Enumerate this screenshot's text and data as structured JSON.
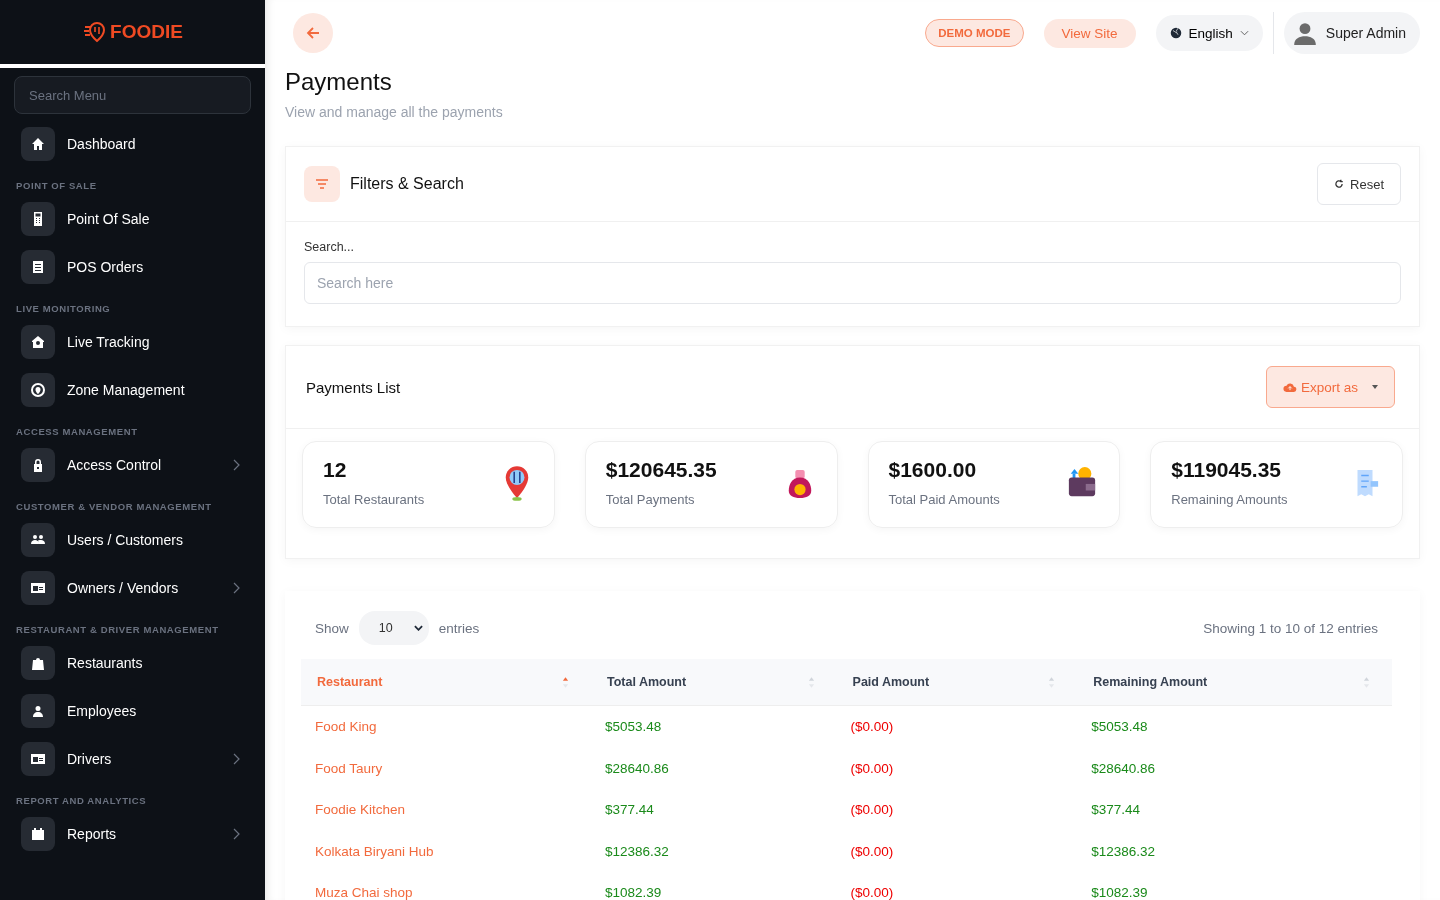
{
  "brand": "FOODIE",
  "sidebar": {
    "search_placeholder": "Search Menu",
    "sections": [
      {
        "items": [
          {
            "label": "Dashboard",
            "has_submenu": false
          }
        ]
      },
      {
        "heading": "POINT OF SALE",
        "items": [
          {
            "label": "Point Of Sale",
            "has_submenu": false
          },
          {
            "label": "POS Orders",
            "has_submenu": false
          }
        ]
      },
      {
        "heading": "LIVE MONITORING",
        "items": [
          {
            "label": "Live Tracking",
            "has_submenu": false
          },
          {
            "label": "Zone Management",
            "has_submenu": false
          }
        ]
      },
      {
        "heading": "ACCESS MANAGEMENT",
        "items": [
          {
            "label": "Access Control",
            "has_submenu": true
          }
        ]
      },
      {
        "heading": "CUSTOMER & VENDOR MANAGEMENT",
        "items": [
          {
            "label": "Users / Customers",
            "has_submenu": false
          },
          {
            "label": "Owners / Vendors",
            "has_submenu": true
          }
        ]
      },
      {
        "heading": "RESTAURANT & DRIVER MANAGEMENT",
        "items": [
          {
            "label": "Restaurants",
            "has_submenu": false
          },
          {
            "label": "Employees",
            "has_submenu": false
          },
          {
            "label": "Drivers",
            "has_submenu": true
          }
        ]
      },
      {
        "heading": "REPORT AND ANALYTICS",
        "items": [
          {
            "label": "Reports",
            "has_submenu": true
          }
        ]
      }
    ]
  },
  "topbar": {
    "demo_badge": "DEMO MODE",
    "view_site": "View Site",
    "language": "English",
    "user": "Super Admin"
  },
  "page": {
    "title": "Payments",
    "subtitle": "View and manage all the payments"
  },
  "filters": {
    "title": "Filters & Search",
    "reset": "Reset",
    "search_label": "Search...",
    "search_placeholder": "Search here"
  },
  "payments_list": {
    "title": "Payments List",
    "export": "Export as",
    "stats": [
      {
        "value": "12",
        "label": "Total Restaurants"
      },
      {
        "value": "$120645.35",
        "label": "Total Payments"
      },
      {
        "value": "$1600.00",
        "label": "Total Paid Amounts"
      },
      {
        "value": "$119045.35",
        "label": "Remaining Amounts"
      }
    ]
  },
  "table": {
    "show_label": "Show",
    "page_size": "10",
    "entries_label": "entries",
    "info": "Showing 1 to 10 of 12 entries",
    "columns": [
      {
        "label": "Restaurant",
        "sorted": true
      },
      {
        "label": "Total Amount",
        "sorted": false
      },
      {
        "label": "Paid Amount",
        "sorted": false
      },
      {
        "label": "Remaining Amount",
        "sorted": false
      }
    ],
    "rows": [
      [
        "Food King",
        "$5053.48",
        "($0.00)",
        "$5053.48"
      ],
      [
        "Food Taury",
        "$28640.86",
        "($0.00)",
        "$28640.86"
      ],
      [
        "Foodie Kitchen",
        "$377.44",
        "($0.00)",
        "$377.44"
      ],
      [
        "Kolkata Biryani Hub",
        "$12386.32",
        "($0.00)",
        "$12386.32"
      ],
      [
        "Muza Chai shop",
        "$1082.39",
        "($0.00)",
        "$1082.39"
      ]
    ]
  }
}
